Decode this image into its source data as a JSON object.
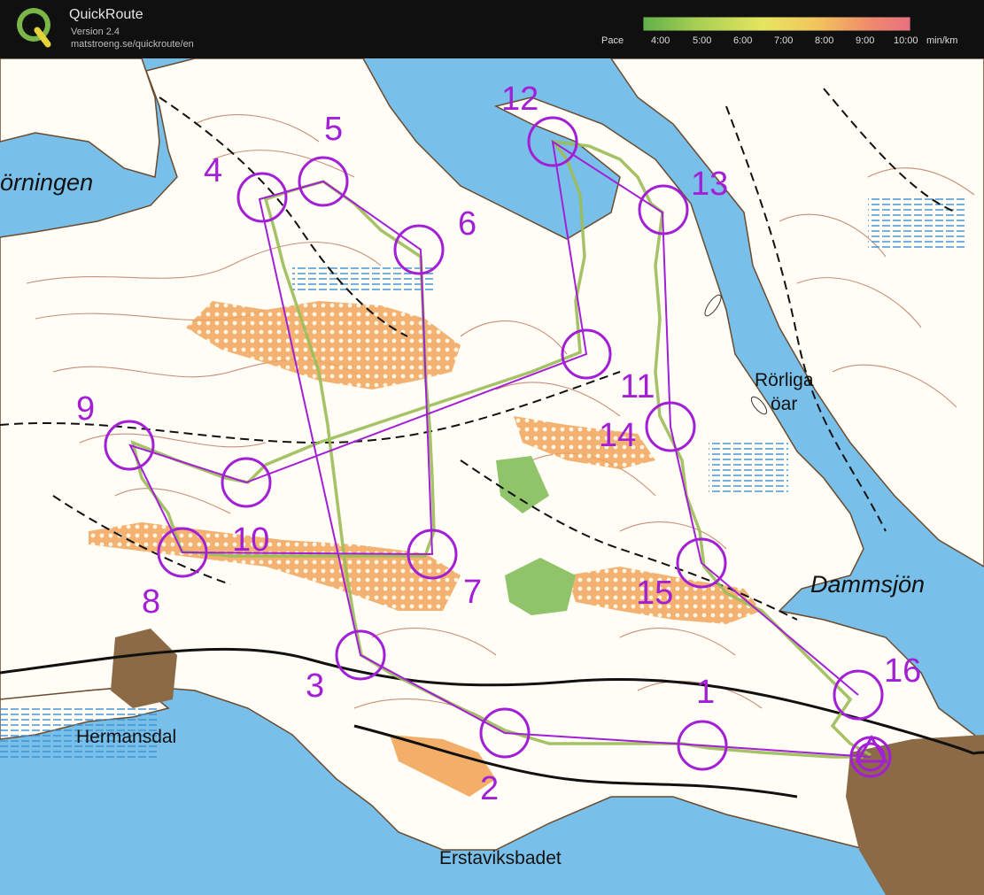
{
  "app": {
    "name": "QuickRoute",
    "version": "Version 2.4",
    "url": "matstroeng.se/quickroute/en",
    "logo_letter": "Q"
  },
  "pace_legend": {
    "label": "Pace",
    "ticks": [
      "4:00",
      "5:00",
      "6:00",
      "7:00",
      "8:00",
      "9:00",
      "10:00"
    ],
    "unit": "min/km",
    "colors": [
      "#5fb04a",
      "#a7cf52",
      "#e6e55e",
      "#f2c45c",
      "#ef8a6c",
      "#e97080"
    ]
  },
  "map": {
    "place_names": {
      "lake_left": "örningen",
      "hermansdal": "Hermansdal",
      "erstaviksbadet": "Erstaviksbadet",
      "rorliga_line1": "Rörliga",
      "rorliga_line2": "öar",
      "dammsjon": "Dammsjön"
    },
    "controls": [
      {
        "label": "1"
      },
      {
        "label": "2"
      },
      {
        "label": "3"
      },
      {
        "label": "4"
      },
      {
        "label": "5"
      },
      {
        "label": "6"
      },
      {
        "label": "7"
      },
      {
        "label": "8"
      },
      {
        "label": "9"
      },
      {
        "label": "10"
      },
      {
        "label": "11"
      },
      {
        "label": "12"
      },
      {
        "label": "13"
      },
      {
        "label": "14"
      },
      {
        "label": "15"
      },
      {
        "label": "16"
      }
    ],
    "colors": {
      "water": "#78bfe9",
      "forest": "#fffdf6",
      "contour": "#b86a4a",
      "course": "#a21fd6",
      "open_land": "#f2a55b",
      "green": "#8fc46a",
      "settlement": "#8c6a45"
    }
  }
}
